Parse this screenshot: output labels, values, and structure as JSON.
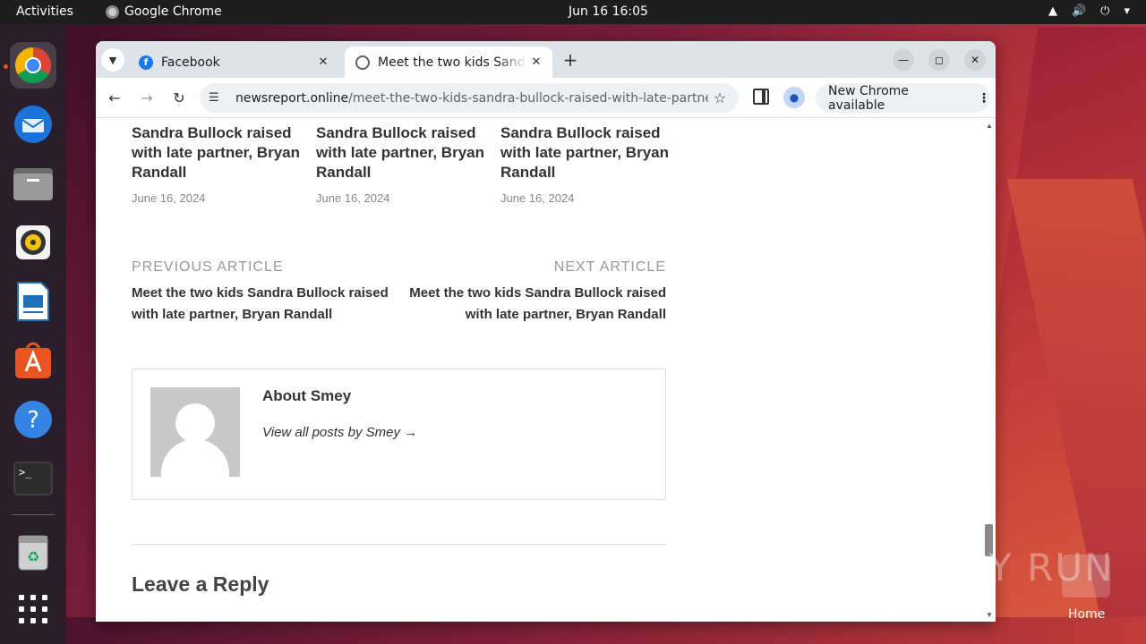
{
  "topbar": {
    "activities": "Activities",
    "app_name": "Google Chrome",
    "clock": "Jun 16  16:05"
  },
  "dock": {
    "items": [
      "chrome-icon",
      "thunderbird-icon",
      "files-icon",
      "rhythmbox-icon",
      "writer-icon",
      "app-center-icon",
      "help-icon",
      "terminal-icon",
      "trash-icon",
      "apps-grid-icon"
    ]
  },
  "browser": {
    "tabs": [
      {
        "title": "Facebook"
      },
      {
        "title": "Meet the two kids Sandra"
      }
    ],
    "url_host": "newsreport.online",
    "url_path": "/meet-the-two-kids-sandra-bullock-raised-with-late-partner-b...",
    "update_label": "New Chrome available"
  },
  "page": {
    "related": [
      {
        "title": "Sandra Bullock raised with late partner, Bryan Randall",
        "date": "June 16, 2024"
      },
      {
        "title": "Sandra Bullock raised with late partner, Bryan Randall",
        "date": "June 16, 2024"
      },
      {
        "title": "Sandra Bullock raised with late partner, Bryan Randall",
        "date": "June 16, 2024"
      }
    ],
    "prev_label": "PREVIOUS ARTICLE",
    "prev_title": "Meet the two kids Sandra Bullock raised with late partner, Bryan Randall",
    "next_label": "NEXT ARTICLE",
    "next_title": "Meet the two kids Sandra Bullock raised with late partner, Bryan Randall",
    "about": "About Smey",
    "view_all": "View all posts by Smey →",
    "reply_heading": "Leave a Reply"
  },
  "desktop": {
    "watermark": "ANY RUN",
    "home_label": "Home"
  }
}
